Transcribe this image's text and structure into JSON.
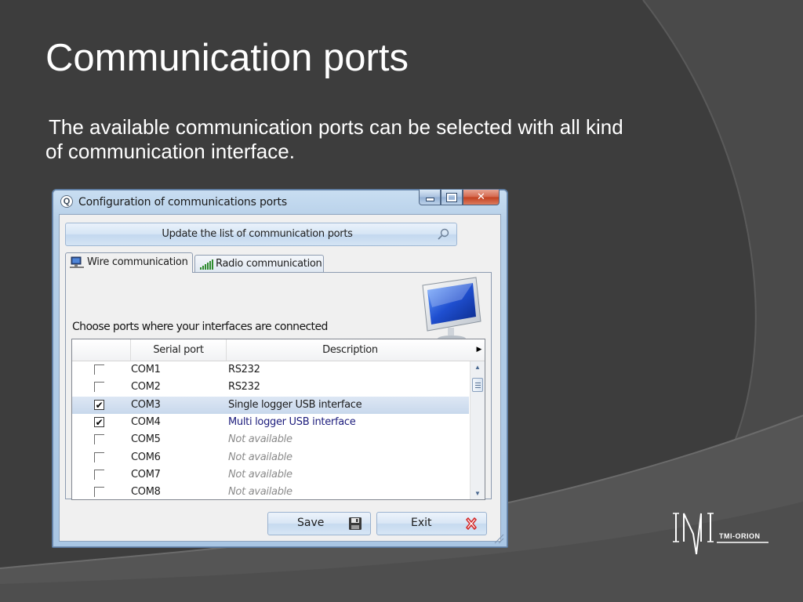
{
  "slide": {
    "title": "Communication ports",
    "body_line1": "The available communication ports can be selected with all kind",
    "body_line2": "of communication interface."
  },
  "window": {
    "title": "Configuration of communications ports",
    "app_icon_glyph": "Q",
    "close_glyph": "✕",
    "update_button_label": "Update the list of communication ports",
    "tabs": [
      {
        "label": "Wire communication",
        "icon": "wired-network-icon",
        "active": true
      },
      {
        "label": "Radio communication",
        "icon": "signal-bars-icon",
        "active": false
      }
    ],
    "choose_label": "Choose ports where your interfaces are connected",
    "columns": [
      "",
      "Serial port",
      "Description"
    ],
    "rows": [
      {
        "checked": false,
        "port": "COM1",
        "description": "RS232",
        "style": "normal"
      },
      {
        "checked": false,
        "port": "COM2",
        "description": "RS232",
        "style": "normal"
      },
      {
        "checked": true,
        "port": "COM3",
        "description": "Single logger USB interface",
        "style": "selected"
      },
      {
        "checked": true,
        "port": "COM4",
        "description": "Multi logger USB interface",
        "style": "navy"
      },
      {
        "checked": false,
        "port": "COM5",
        "description": "Not available",
        "style": "na"
      },
      {
        "checked": false,
        "port": "COM6",
        "description": "Not available",
        "style": "na"
      },
      {
        "checked": false,
        "port": "COM7",
        "description": "Not available",
        "style": "na"
      },
      {
        "checked": false,
        "port": "COM8",
        "description": "Not available",
        "style": "na"
      }
    ],
    "save_label": "Save",
    "exit_label": "Exit"
  },
  "logo": {
    "mark": "IMI",
    "text": "TMI-ORION"
  },
  "colors": {
    "slide_background": "#3d3d3d",
    "window_frame": "#b6cfe8",
    "close_button": "#c8462a",
    "selected_row": "#d0ddef",
    "navy_text": "#1c1c7c",
    "unavailable_text": "#8a8a8a"
  }
}
